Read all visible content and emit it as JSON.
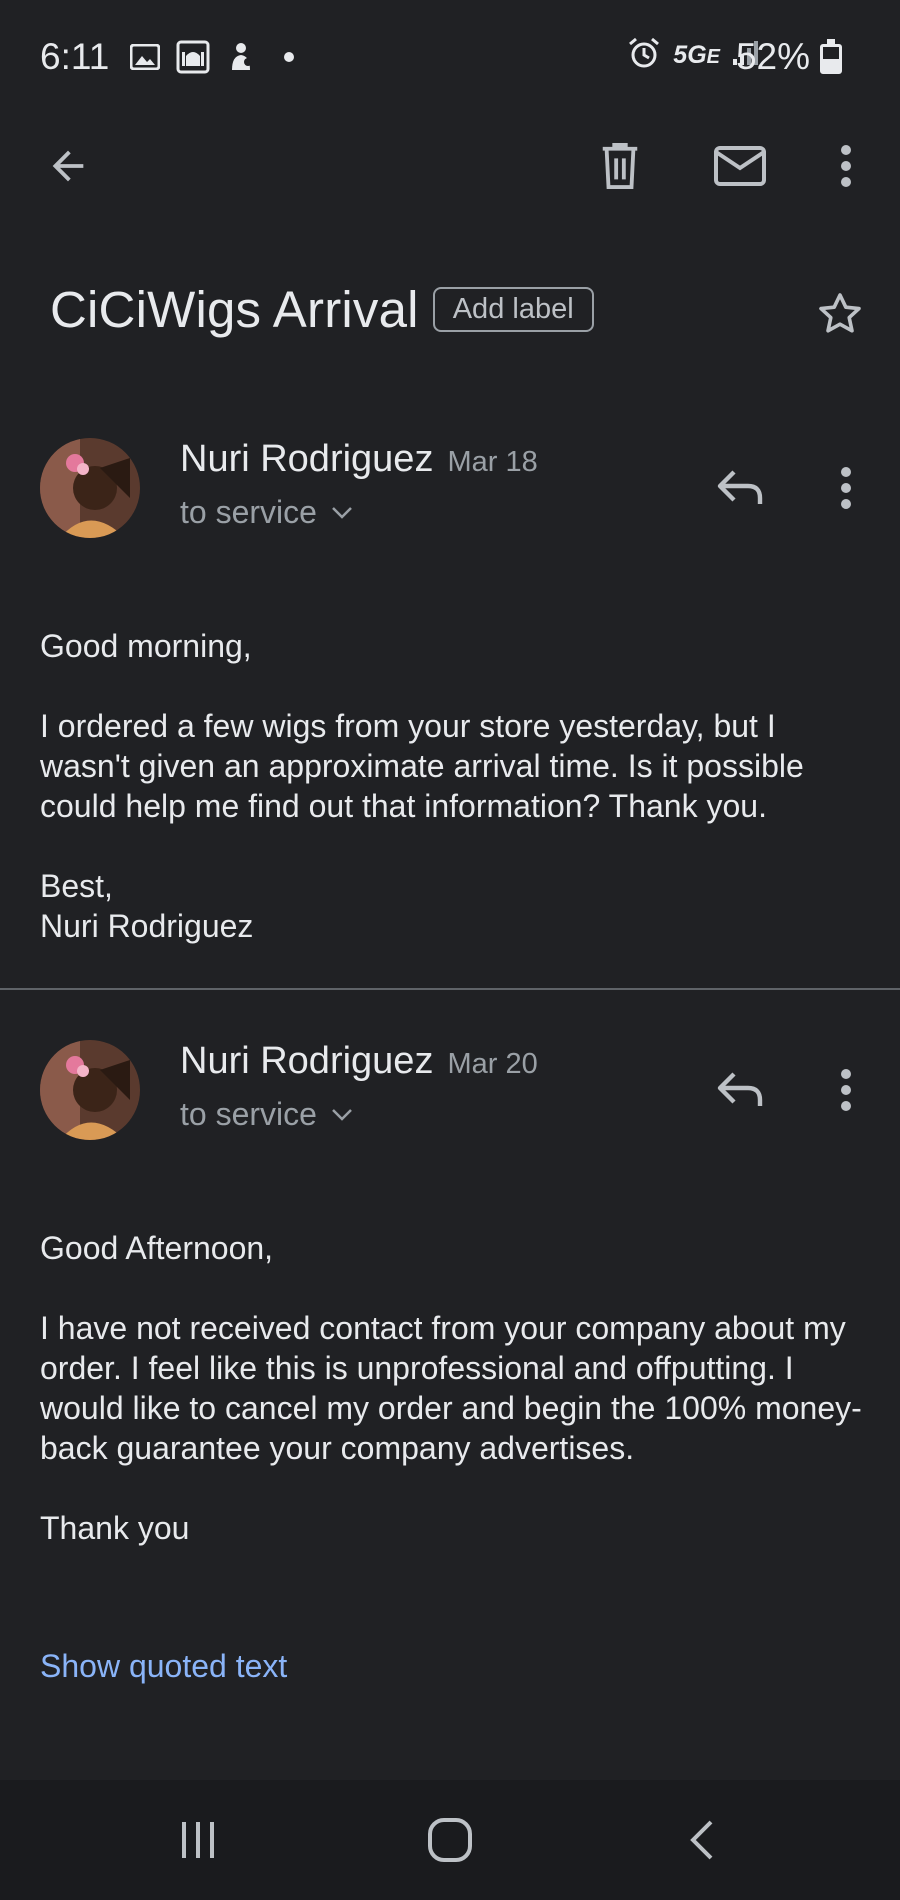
{
  "status_bar": {
    "time": "6:11",
    "network": "5G",
    "network_sub": "E",
    "battery": "52%",
    "battery_fraction": 0.52,
    "icons": [
      "gallery-icon",
      "mosque-icon",
      "app-icon",
      "dot-icon",
      "alarm-icon",
      "signal-icon",
      "battery-icon"
    ]
  },
  "toolbar": {
    "back_icon": "arrow-back-icon",
    "delete_icon": "trash-icon",
    "mark_unread_icon": "mail-icon",
    "more_icon": "more-vert-icon"
  },
  "thread": {
    "subject": "CiCiWigs Arrival",
    "label_button": "Add label",
    "star_icon": "star-outline-icon"
  },
  "messages": [
    {
      "sender": "Nuri Rodriguez",
      "date": "Mar 18",
      "recipient": "to service",
      "greeting": "Good morning,",
      "paragraph": "I ordered a few wigs from your store yesterday, but I wasn't given an approximate arrival time. Is it possible could help me find out that information? Thank you.",
      "sign_off": "Best,",
      "signature": "Nuri Rodriguez"
    },
    {
      "sender": "Nuri Rodriguez",
      "date": "Mar 20",
      "recipient": "to service",
      "greeting": "Good Afternoon,",
      "paragraph": "I have not received contact from your company about my order. I feel like this is unprofessional and offputting. I would like to cancel my order and begin the 100% money-back guarantee your company advertises.",
      "sign_off": "Thank you",
      "show_quoted": "Show quoted text"
    }
  ],
  "nav_bar": {
    "recents_icon": "recents-icon",
    "home_icon": "home-icon",
    "back_icon": "nav-back-icon"
  }
}
